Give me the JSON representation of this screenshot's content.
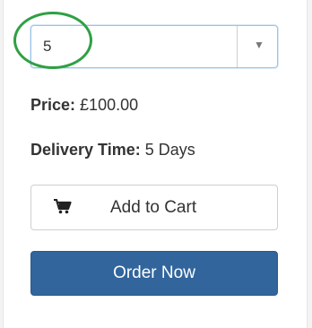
{
  "quantity_select": {
    "selected_value": "5"
  },
  "price": {
    "label": "Price:",
    "value": "£100.00"
  },
  "delivery": {
    "label": "Delivery Time:",
    "value": "5 Days"
  },
  "buttons": {
    "add_to_cart": "Add to Cart",
    "order_now": "Order Now"
  },
  "icons": {
    "cart": "cart-icon",
    "dropdown": "triangle-down-icon"
  },
  "colors": {
    "order_button": "#31659c",
    "highlight_circle": "#2fa043",
    "select_border": "#9ec3e6"
  }
}
